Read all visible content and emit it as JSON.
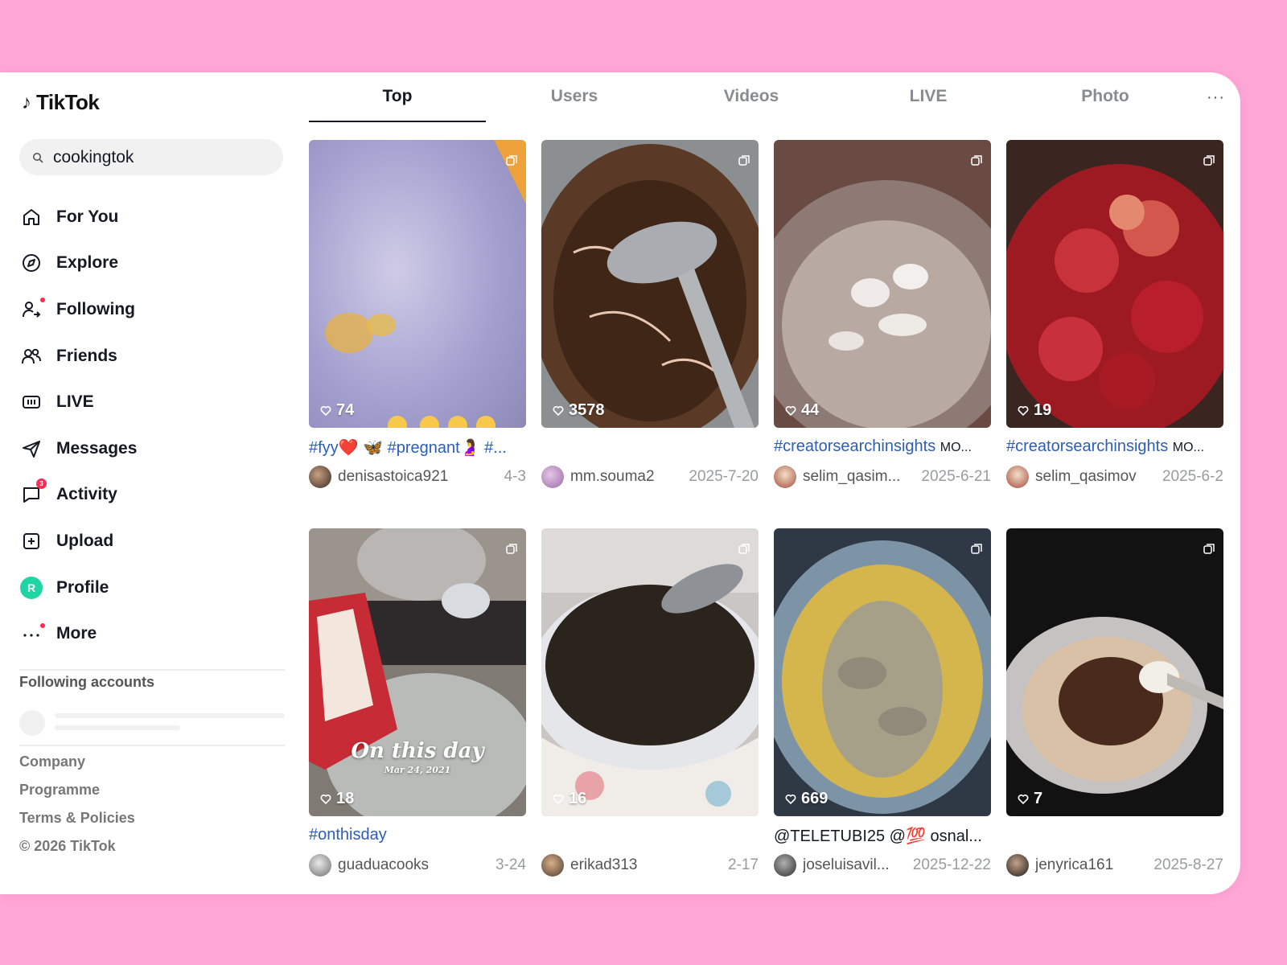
{
  "app": {
    "name": "TikTok",
    "logo_glyph": "♪"
  },
  "search": {
    "value": "cookingtok",
    "icon": "search-icon"
  },
  "sidebar": {
    "items": [
      {
        "label": "For You",
        "icon": "home-icon"
      },
      {
        "label": "Explore",
        "icon": "compass-icon"
      },
      {
        "label": "Following",
        "icon": "following-icon"
      },
      {
        "label": "Friends",
        "icon": "friends-icon"
      },
      {
        "label": "LIVE",
        "icon": "live-icon"
      },
      {
        "label": "Messages",
        "icon": "send-icon"
      },
      {
        "label": "Activity",
        "icon": "chat-icon",
        "badge": "3"
      },
      {
        "label": "Upload",
        "icon": "plus-square-icon"
      },
      {
        "label": "Profile",
        "icon": "avatar",
        "avatar_letter": "R"
      },
      {
        "label": "More",
        "icon": "more-icon"
      }
    ],
    "following_title": "Following accounts",
    "footer": [
      "Company",
      "Programme",
      "Terms & Policies"
    ],
    "copyright": "© 2026 TikTok"
  },
  "tabs": [
    {
      "label": "Top",
      "active": true
    },
    {
      "label": "Users"
    },
    {
      "label": "Videos"
    },
    {
      "label": "LIVE"
    },
    {
      "label": "Photo"
    }
  ],
  "tabs_more": "···",
  "results": [
    {
      "likes": "74",
      "caption": "#fyy❤️ 🦋  #pregnant🤰  #...",
      "user": "denisastoica921",
      "date": "4-3"
    },
    {
      "likes": "3578",
      "caption": "",
      "user": "mm.souma2",
      "date": "2025-7-20"
    },
    {
      "likes": "44",
      "caption": "#creatorsearchinsights",
      "caption_extra": "MO...",
      "user": "selim_qasim...",
      "date": "2025-6-21"
    },
    {
      "likes": "19",
      "caption": "#creatorsearchinsights",
      "caption_extra": "MO...",
      "user": "selim_qasimov",
      "date": "2025-6-2"
    },
    {
      "likes": "18",
      "caption": "#onthisday",
      "user": "guaduacooks",
      "date": "3-24",
      "overlay_title": "On this day",
      "overlay_date": "Mar 24, 2021"
    },
    {
      "likes": "16",
      "caption": "",
      "user": "erikad313",
      "date": "2-17"
    },
    {
      "likes": "669",
      "caption_dark": "@TELETUBI25 @💯  osnal...",
      "user": "joseluisavil...",
      "date": "2025-12-22"
    },
    {
      "likes": "7",
      "caption": "",
      "user": "jenyrica161",
      "date": "2025-8-27"
    }
  ],
  "colors": {
    "background": "#ffa6d6",
    "hashtag": "#2b5db9",
    "accent": "#fe2c55",
    "profile_avatar": "#20d5a4"
  }
}
